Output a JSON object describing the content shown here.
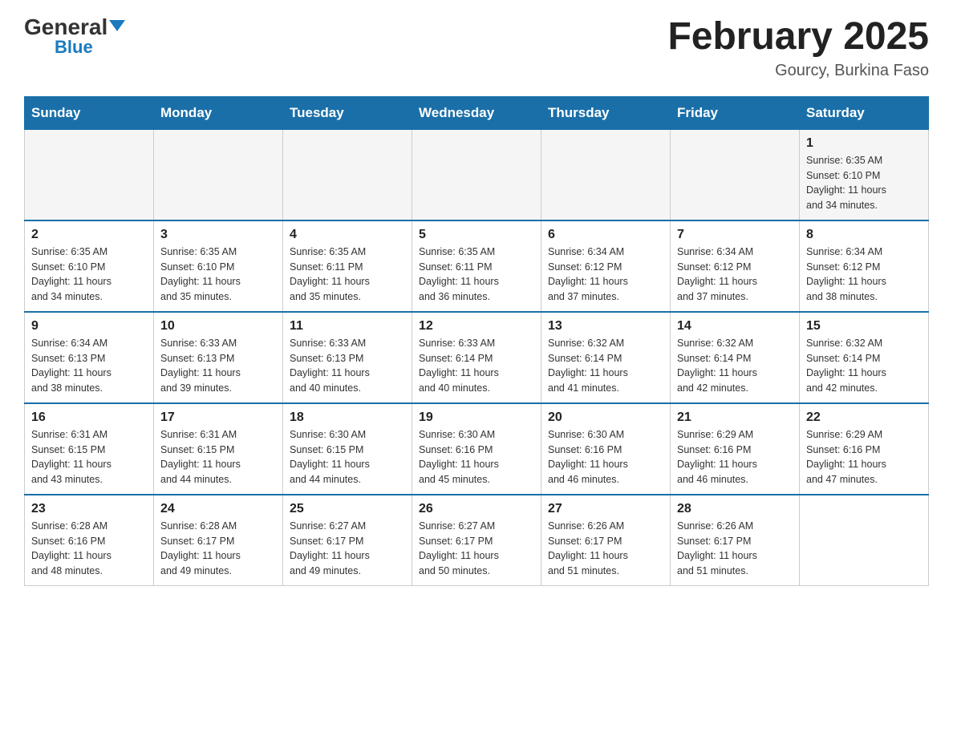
{
  "header": {
    "logo_general": "General",
    "logo_blue": "Blue",
    "calendar_title": "February 2025",
    "location": "Gourcy, Burkina Faso"
  },
  "weekdays": [
    "Sunday",
    "Monday",
    "Tuesday",
    "Wednesday",
    "Thursday",
    "Friday",
    "Saturday"
  ],
  "weeks": [
    [
      {
        "day": "",
        "info": ""
      },
      {
        "day": "",
        "info": ""
      },
      {
        "day": "",
        "info": ""
      },
      {
        "day": "",
        "info": ""
      },
      {
        "day": "",
        "info": ""
      },
      {
        "day": "",
        "info": ""
      },
      {
        "day": "1",
        "info": "Sunrise: 6:35 AM\nSunset: 6:10 PM\nDaylight: 11 hours\nand 34 minutes."
      }
    ],
    [
      {
        "day": "2",
        "info": "Sunrise: 6:35 AM\nSunset: 6:10 PM\nDaylight: 11 hours\nand 34 minutes."
      },
      {
        "day": "3",
        "info": "Sunrise: 6:35 AM\nSunset: 6:10 PM\nDaylight: 11 hours\nand 35 minutes."
      },
      {
        "day": "4",
        "info": "Sunrise: 6:35 AM\nSunset: 6:11 PM\nDaylight: 11 hours\nand 35 minutes."
      },
      {
        "day": "5",
        "info": "Sunrise: 6:35 AM\nSunset: 6:11 PM\nDaylight: 11 hours\nand 36 minutes."
      },
      {
        "day": "6",
        "info": "Sunrise: 6:34 AM\nSunset: 6:12 PM\nDaylight: 11 hours\nand 37 minutes."
      },
      {
        "day": "7",
        "info": "Sunrise: 6:34 AM\nSunset: 6:12 PM\nDaylight: 11 hours\nand 37 minutes."
      },
      {
        "day": "8",
        "info": "Sunrise: 6:34 AM\nSunset: 6:12 PM\nDaylight: 11 hours\nand 38 minutes."
      }
    ],
    [
      {
        "day": "9",
        "info": "Sunrise: 6:34 AM\nSunset: 6:13 PM\nDaylight: 11 hours\nand 38 minutes."
      },
      {
        "day": "10",
        "info": "Sunrise: 6:33 AM\nSunset: 6:13 PM\nDaylight: 11 hours\nand 39 minutes."
      },
      {
        "day": "11",
        "info": "Sunrise: 6:33 AM\nSunset: 6:13 PM\nDaylight: 11 hours\nand 40 minutes."
      },
      {
        "day": "12",
        "info": "Sunrise: 6:33 AM\nSunset: 6:14 PM\nDaylight: 11 hours\nand 40 minutes."
      },
      {
        "day": "13",
        "info": "Sunrise: 6:32 AM\nSunset: 6:14 PM\nDaylight: 11 hours\nand 41 minutes."
      },
      {
        "day": "14",
        "info": "Sunrise: 6:32 AM\nSunset: 6:14 PM\nDaylight: 11 hours\nand 42 minutes."
      },
      {
        "day": "15",
        "info": "Sunrise: 6:32 AM\nSunset: 6:14 PM\nDaylight: 11 hours\nand 42 minutes."
      }
    ],
    [
      {
        "day": "16",
        "info": "Sunrise: 6:31 AM\nSunset: 6:15 PM\nDaylight: 11 hours\nand 43 minutes."
      },
      {
        "day": "17",
        "info": "Sunrise: 6:31 AM\nSunset: 6:15 PM\nDaylight: 11 hours\nand 44 minutes."
      },
      {
        "day": "18",
        "info": "Sunrise: 6:30 AM\nSunset: 6:15 PM\nDaylight: 11 hours\nand 44 minutes."
      },
      {
        "day": "19",
        "info": "Sunrise: 6:30 AM\nSunset: 6:16 PM\nDaylight: 11 hours\nand 45 minutes."
      },
      {
        "day": "20",
        "info": "Sunrise: 6:30 AM\nSunset: 6:16 PM\nDaylight: 11 hours\nand 46 minutes."
      },
      {
        "day": "21",
        "info": "Sunrise: 6:29 AM\nSunset: 6:16 PM\nDaylight: 11 hours\nand 46 minutes."
      },
      {
        "day": "22",
        "info": "Sunrise: 6:29 AM\nSunset: 6:16 PM\nDaylight: 11 hours\nand 47 minutes."
      }
    ],
    [
      {
        "day": "23",
        "info": "Sunrise: 6:28 AM\nSunset: 6:16 PM\nDaylight: 11 hours\nand 48 minutes."
      },
      {
        "day": "24",
        "info": "Sunrise: 6:28 AM\nSunset: 6:17 PM\nDaylight: 11 hours\nand 49 minutes."
      },
      {
        "day": "25",
        "info": "Sunrise: 6:27 AM\nSunset: 6:17 PM\nDaylight: 11 hours\nand 49 minutes."
      },
      {
        "day": "26",
        "info": "Sunrise: 6:27 AM\nSunset: 6:17 PM\nDaylight: 11 hours\nand 50 minutes."
      },
      {
        "day": "27",
        "info": "Sunrise: 6:26 AM\nSunset: 6:17 PM\nDaylight: 11 hours\nand 51 minutes."
      },
      {
        "day": "28",
        "info": "Sunrise: 6:26 AM\nSunset: 6:17 PM\nDaylight: 11 hours\nand 51 minutes."
      },
      {
        "day": "",
        "info": ""
      }
    ]
  ]
}
